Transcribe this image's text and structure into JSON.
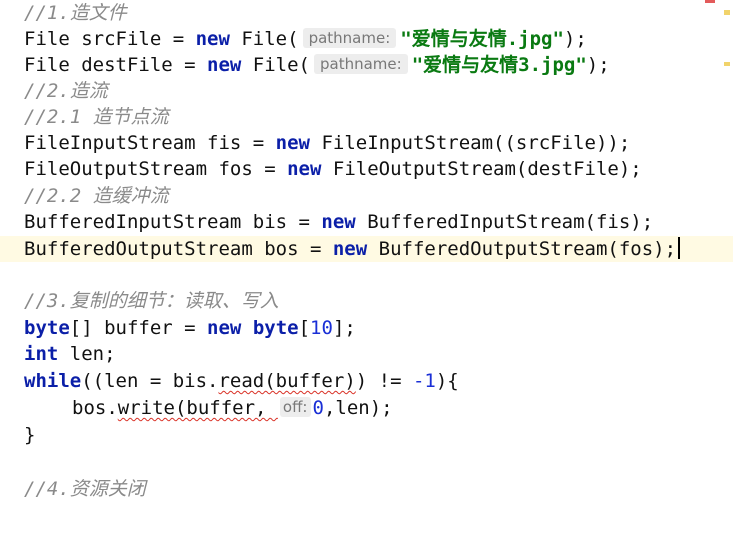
{
  "lines": {
    "l1": {
      "comment": "//1.造文件"
    },
    "l2": {
      "t1": "File srcFile = ",
      "kw": "new",
      "t2": " File(",
      "hint": "pathname:",
      "str": "\"爱情与友情.jpg\"",
      "t3": ");"
    },
    "l3": {
      "t1": "File destFile = ",
      "kw": "new",
      "t2": " File(",
      "hint": "pathname:",
      "str": "\"爱情与友情3.jpg\"",
      "t3": ");"
    },
    "l4": {
      "comment": "//2.造流"
    },
    "l5": {
      "comment": "//2.1 造节点流"
    },
    "l6": {
      "t1": "FileInputStream fis = ",
      "kw": "new",
      "t2": " FileInputStream((srcFile));"
    },
    "l7": {
      "t1": "FileOutputStream fos = ",
      "kw": "new",
      "t2": " FileOutputStream(destFile);"
    },
    "l8": {
      "comment": "//2.2 造缓冲流"
    },
    "l9": {
      "t1": "BufferedInputStream bis = ",
      "kw": "new",
      "t2": " BufferedInputStream(fis);"
    },
    "l10": {
      "t1": "BufferedOutputStream bos = ",
      "kw": "new",
      "t2": " BufferedOutputStream(fos);"
    },
    "l12": {
      "comment": "//3.复制的细节：读取、写入"
    },
    "l13": {
      "kw1": "byte",
      "t1": "[] buffer = ",
      "kw2": "new",
      "t2": " ",
      "kw3": "byte",
      "t3": "[",
      "num": "10",
      "t4": "];"
    },
    "l14": {
      "kw": "int",
      "t1": " len;"
    },
    "l15": {
      "kw": "while",
      "t1": "((len = bis.",
      "u1": "read(buffer)",
      "t2": ") != ",
      "num": "-1",
      "t3": "){"
    },
    "l16": {
      "t1": "bos.",
      "u1": "write(buffer, ",
      "hint": "off:",
      "num": "0",
      "t2": ",len);"
    },
    "l17": {
      "t1": "}"
    },
    "l19": {
      "comment": "//4.资源关闭"
    }
  },
  "colors": {
    "keyword": "#0b1fa8",
    "string": "#0a7a12",
    "comment": "#8a8a8a",
    "number": "#1a2fd6",
    "current_line": "#fffae3"
  }
}
